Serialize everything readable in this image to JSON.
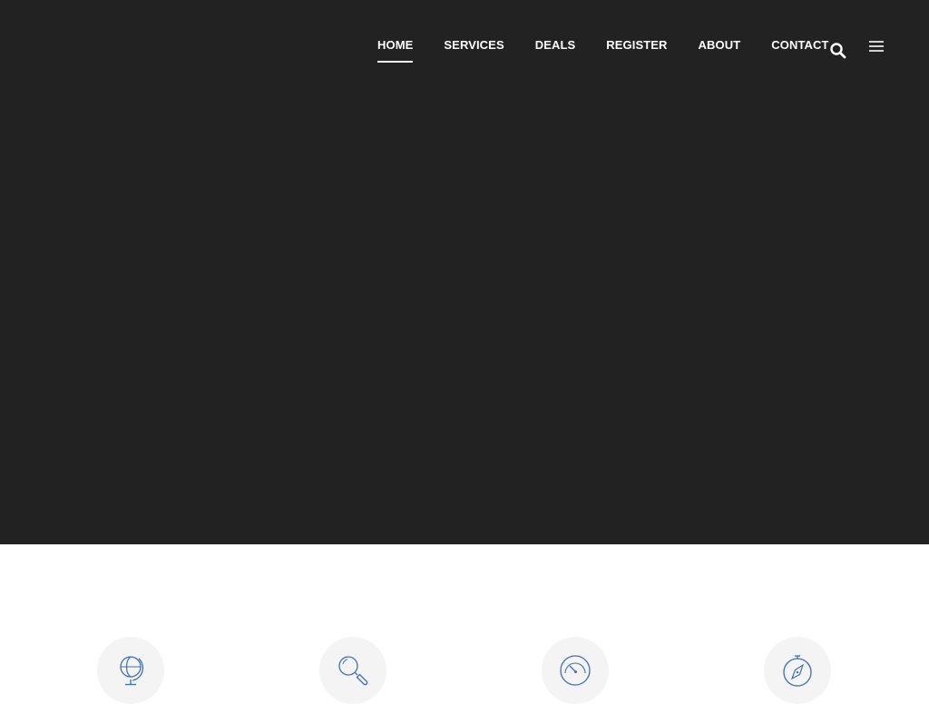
{
  "nav": {
    "items": [
      {
        "label": "HOME",
        "active": true
      },
      {
        "label": "SERVICES",
        "active": false
      },
      {
        "label": "DEALS",
        "active": false
      },
      {
        "label": "REGISTER",
        "active": false
      },
      {
        "label": "ABOUT",
        "active": false
      },
      {
        "label": "CONTACT",
        "active": false
      }
    ],
    "search_icon": "search-icon",
    "menu_icon": "hamburger-menu-icon"
  },
  "colors": {
    "hero_background": "#222222",
    "nav_text": "#ffffff",
    "feature_icon_stroke": "#3b6fb6",
    "feature_circle": "#f4f4f4"
  },
  "features": [
    {
      "icon": "globe-icon"
    },
    {
      "icon": "magnifier-icon"
    },
    {
      "icon": "speedometer-icon"
    },
    {
      "icon": "compass-icon"
    }
  ]
}
